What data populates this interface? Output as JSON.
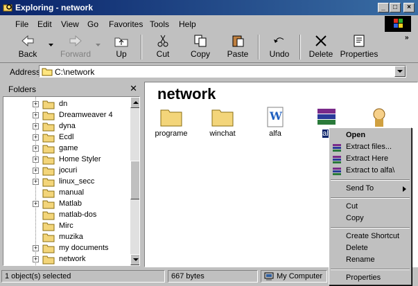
{
  "window": {
    "title": "Exploring - network"
  },
  "menu": [
    "File",
    "Edit",
    "View",
    "Go",
    "Favorites",
    "Tools",
    "Help"
  ],
  "toolbar": {
    "back": "Back",
    "forward": "Forward",
    "up": "Up",
    "cut": "Cut",
    "copy": "Copy",
    "paste": "Paste",
    "undo": "Undo",
    "delete": "Delete",
    "properties": "Properties"
  },
  "address": {
    "label": "Address",
    "value": "C:\\network"
  },
  "folders": {
    "title": "Folders",
    "items": [
      "dn",
      "Dreamweaver 4",
      "dyna",
      "Ecdl",
      "game",
      "Home Styler",
      "jocuri",
      "linux_secc",
      "manual",
      "Matlab",
      "matlab-dos",
      "Mirc",
      "muzika",
      "my documents",
      "network"
    ]
  },
  "content": {
    "title": "network",
    "files": [
      {
        "name": "programe"
      },
      {
        "name": "winchat"
      },
      {
        "name": "alfa"
      },
      {
        "name": "alf"
      },
      {
        "name": ""
      }
    ]
  },
  "context_menu": {
    "open": "Open",
    "extract_files": "Extract files...",
    "extract_here": "Extract Here",
    "extract_to": "Extract to alfa\\",
    "send_to": "Send To",
    "cut": "Cut",
    "copy": "Copy",
    "create_shortcut": "Create Shortcut",
    "delete": "Delete",
    "rename": "Rename",
    "properties": "Properties"
  },
  "status": {
    "selected": "1 object(s) selected",
    "size": "667 bytes",
    "location": "My Computer"
  }
}
